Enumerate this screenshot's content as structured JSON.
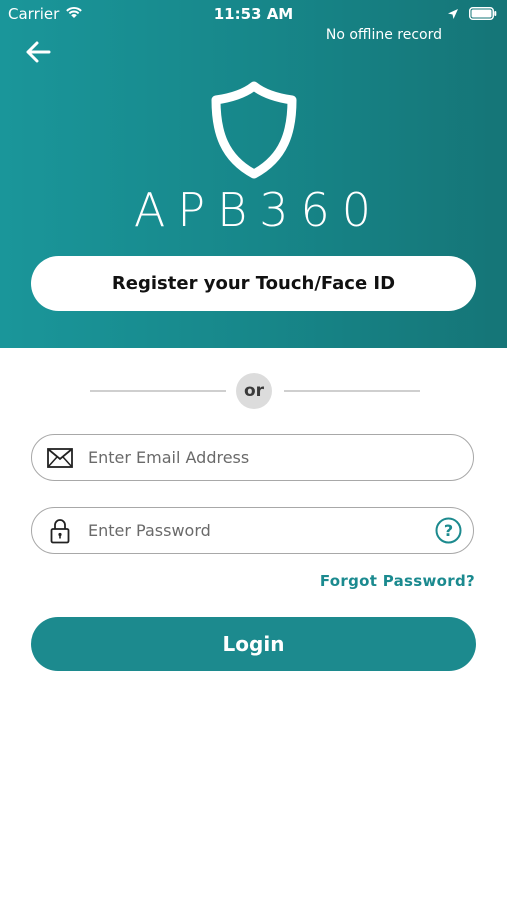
{
  "status_bar": {
    "carrier": "Carrier",
    "time": "11:53 AM"
  },
  "header": {
    "offline_status": "No offline record",
    "logo_text": "APB360",
    "touch_button_label": "Register your Touch/Face ID"
  },
  "divider": {
    "label": "or"
  },
  "form": {
    "email_placeholder": "Enter Email Address",
    "email_value": "",
    "password_placeholder": "Enter Password",
    "password_value": "",
    "forgot_label": "Forgot Password?",
    "login_label": "Login"
  },
  "icons": {
    "back": "arrow-left-icon",
    "email": "envelope-icon",
    "password": "lock-icon",
    "help": "question-circle-icon",
    "wifi": "wifi-icon",
    "location": "location-arrow-icon",
    "battery": "battery-icon",
    "logo": "shield-icon"
  },
  "colors": {
    "brand": "#1c8a8e",
    "header_gradient_start": "#1a969a",
    "header_gradient_end": "#157577",
    "link": "#1b8a8f"
  }
}
